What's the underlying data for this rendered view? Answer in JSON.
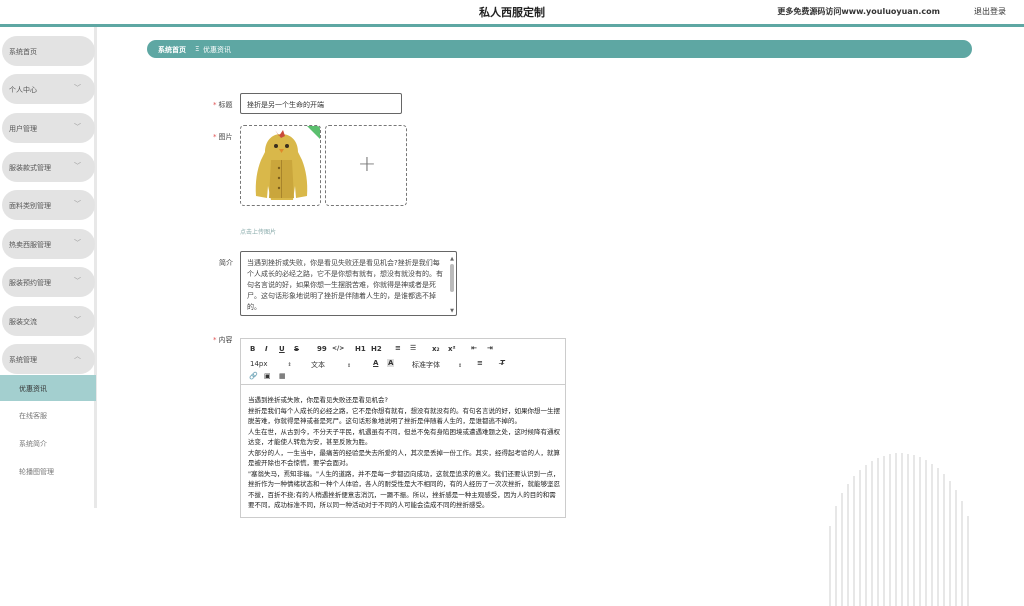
{
  "header": {
    "title": "私人西服定制",
    "promo": "更多免费源码访问www.youluoyuan.com",
    "logout": "退出登录"
  },
  "sidebar": {
    "items": [
      {
        "label": "系统首页",
        "chevron": false
      },
      {
        "label": "个人中心",
        "chevron": true
      },
      {
        "label": "用户管理",
        "chevron": true
      },
      {
        "label": "服装款式管理",
        "chevron": true
      },
      {
        "label": "面料类别管理",
        "chevron": true
      },
      {
        "label": "热卖西服管理",
        "chevron": true
      },
      {
        "label": "服装预约管理",
        "chevron": true
      },
      {
        "label": "服装交流",
        "chevron": true
      },
      {
        "label": "系统管理",
        "chevron": true
      }
    ],
    "submenu": [
      {
        "label": "优惠资讯",
        "active": true
      },
      {
        "label": "在线客服",
        "active": false
      },
      {
        "label": "系统简介",
        "active": false
      },
      {
        "label": "轮播图管理",
        "active": false
      }
    ]
  },
  "breadcrumb": {
    "home": "系统首页",
    "separator": "Ξ",
    "current": "优惠资讯"
  },
  "form": {
    "title_label": "标题",
    "title_value": "挫折是另一个生命的开端",
    "image_label": "图片",
    "upload_hint": "点击上传图片",
    "intro_label": "简介",
    "intro_value": "当遇到挫折或失败，你是看见失败还是看见机会?挫折是我们每个人成长的必经之路，它不是你想有就有，想没有就没有的。有句名言说的好，如果你想一生摆脱苦难，你就得是神或者是死尸。这句话形象地说明了挫折是伴随着人生的，是谁都逃不掉的。",
    "content_label": "内容",
    "required_mark": "*"
  },
  "toolbar": {
    "row1": [
      "B",
      "I",
      "U",
      "S",
      "99",
      "</>",
      "H1",
      "H2",
      "≡",
      "☰",
      "x₂",
      "x²",
      "⇤",
      "⇥"
    ],
    "size": "14px",
    "paragraph": "文本",
    "font": "标准字体"
  },
  "editor": {
    "paragraphs": [
      "当遇到挫折或失败，你是看见失败还是看见机会?",
      "挫折是我们每个人成长的必经之路，它不是你想有就有，想没有就没有的。有句名言说的好，如果你想一生摆脱苦难，你就得是神或者是死尸。这句话形象地说明了挫折是伴随着人生的，是谁都逃不掉的。",
      "人生在世，从古到今，不分天子平民，机遇虽有不同，但总不免有身陷困境或遭遇难题之处，这时候降有通权达变，才能使人转危为安，甚至反败为胜。",
      "大部分的人，一生当中，最痛苦的经验是失去所爱的人，其次是丢掉一份工作。其实，经得起考验的人，就算是被开除也不会惊慌，要学会面对。",
      "\"塞翁失马，焉知非福。\"人生的道路，并不是每一步都迈向成功，这就是追求的意义。我们还要认识到一点，挫折作为一种情绪状态和一种个人体验，各人的耐受性是大不相同的，有的人经历了一次次挫折，就能够坚忍不拔，百折不挠;有的人稍遇挫折便意志消沉，一蹶不振。所以，挫折感是一种主观感受，因为人的目的和需要不同，成功标准不同，所以同一种活动对于不同的人可能会造成不同的挫折感受。"
    ]
  },
  "colors": {
    "accent": "#5ea7a3",
    "active_submenu": "#a3cfcf"
  }
}
